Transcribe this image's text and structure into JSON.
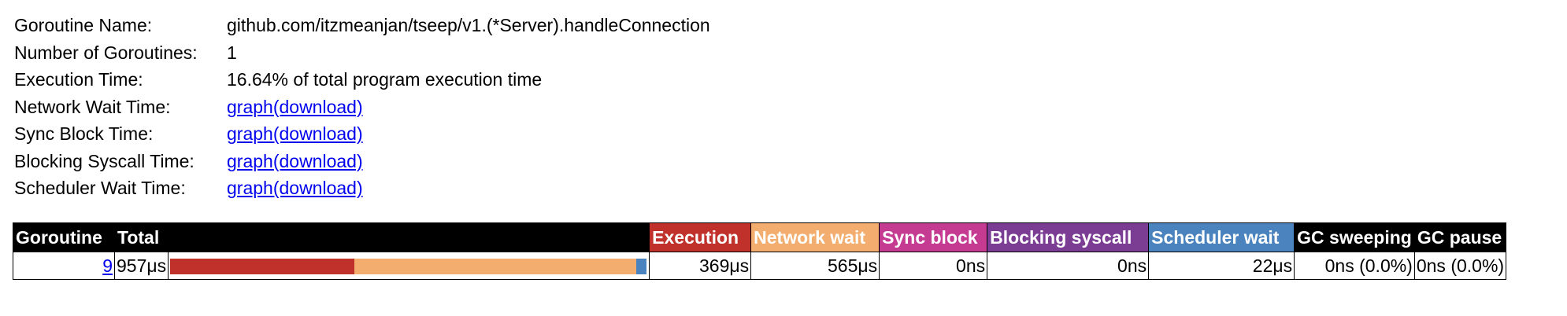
{
  "summary": {
    "rows": [
      {
        "label": "Goroutine Name:",
        "value": "github.com/itzmeanjan/tseep/v1.(*Server).handleConnection",
        "is_link": false
      },
      {
        "label": "Number of Goroutines:",
        "value": "1",
        "is_link": false
      },
      {
        "label": "Execution Time:",
        "value": "16.64% of total program execution time",
        "is_link": false
      },
      {
        "label": "Network Wait Time:",
        "value": "graph(download)",
        "is_link": true
      },
      {
        "label": "Sync Block Time:",
        "value": "graph(download)",
        "is_link": true
      },
      {
        "label": "Blocking Syscall Time:",
        "value": "graph(download)",
        "is_link": true
      },
      {
        "label": "Scheduler Wait Time:",
        "value": "graph(download)",
        "is_link": true
      }
    ]
  },
  "stats_table": {
    "headers": {
      "goroutine": "Goroutine",
      "total": "Total",
      "execution": "Execution",
      "network_wait": "Network wait",
      "sync_block": "Sync block",
      "blocking_syscall": "Blocking syscall",
      "scheduler_wait": "Scheduler wait",
      "gc_sweeping": "GC sweeping",
      "gc_pause": "GC pause"
    },
    "row": {
      "goroutine_id": "9",
      "total": "957μs",
      "execution": "369μs",
      "network_wait": "565μs",
      "sync_block": "0ns",
      "blocking_syscall": "0ns",
      "scheduler_wait": "22μs",
      "gc_sweeping": "0ns (0.0%)",
      "gc_pause": "0ns (0.0%)"
    },
    "bar": {
      "total_us": 957,
      "segments": [
        {
          "name": "execution",
          "value_us": 369,
          "color": "#c0312c"
        },
        {
          "name": "network_wait",
          "value_us": 565,
          "color": "#f3ad6e"
        },
        {
          "name": "sync_block",
          "value_us": 0,
          "color": "#c63b92"
        },
        {
          "name": "blocking_syscall",
          "value_us": 0,
          "color": "#7b3d94"
        },
        {
          "name": "scheduler_wait",
          "value_us": 22,
          "color": "#4a83be"
        }
      ]
    }
  }
}
